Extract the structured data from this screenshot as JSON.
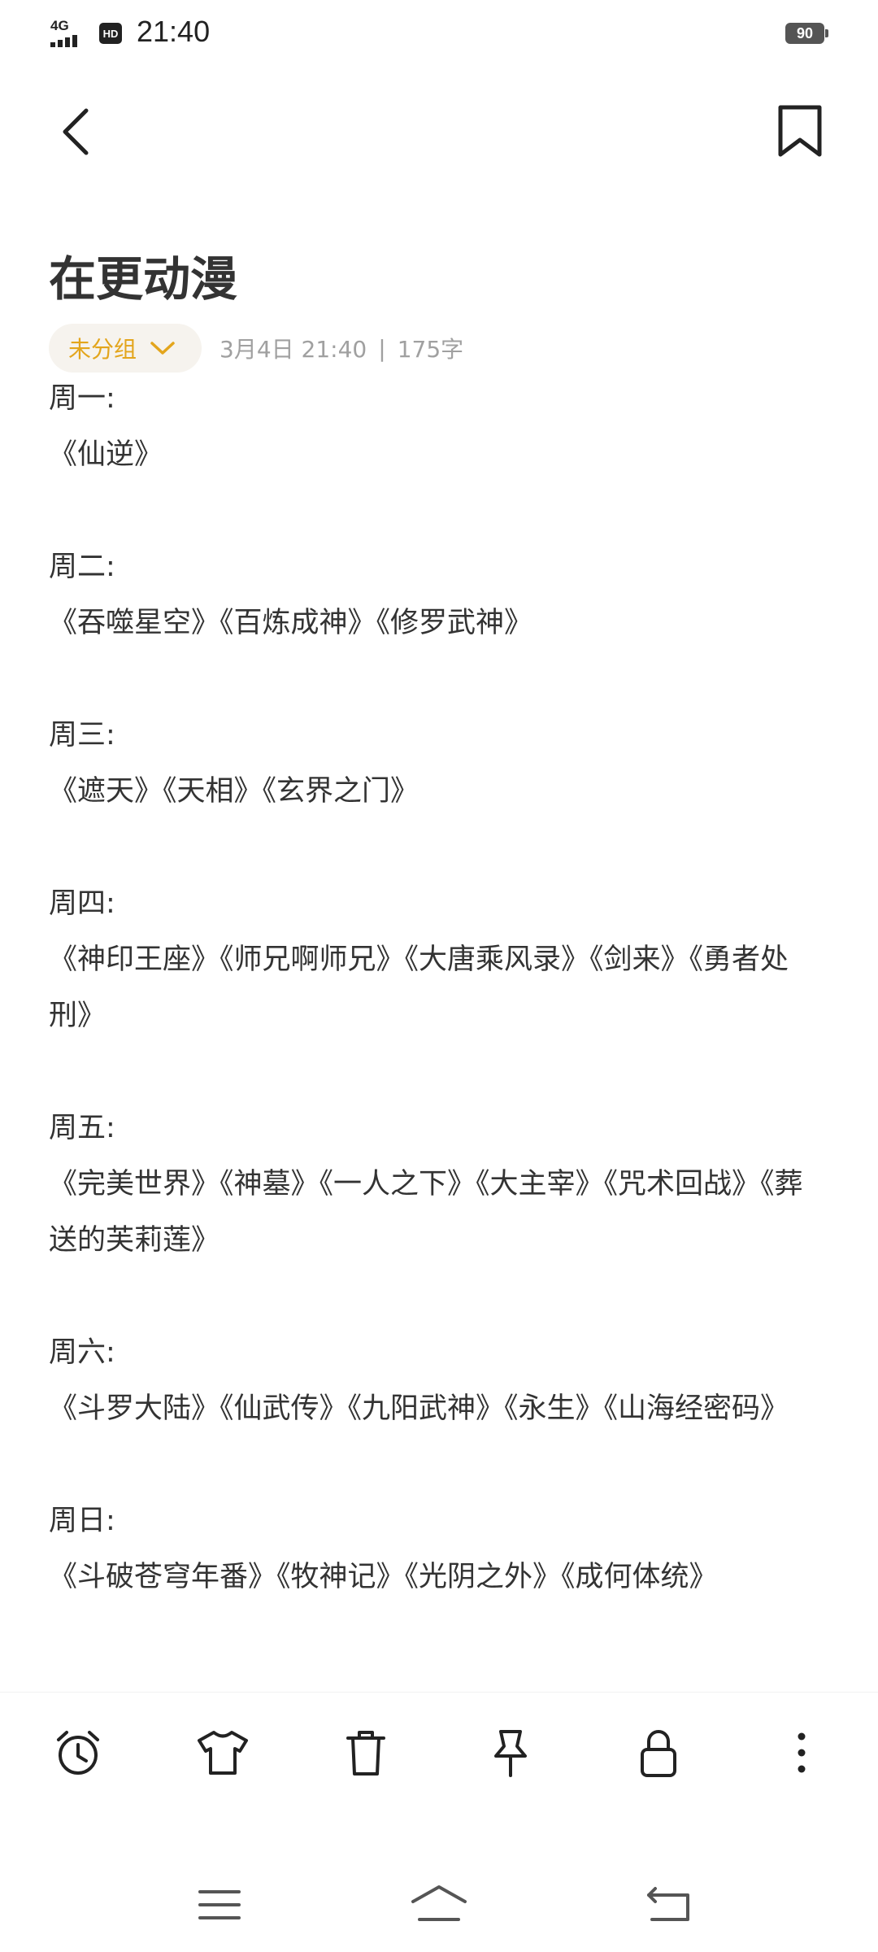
{
  "status_bar": {
    "network": "4G",
    "hd_label": "HD",
    "time": "21:40",
    "battery": "90"
  },
  "icons": {
    "back": "chevron-left-icon",
    "bookmark": "bookmark-icon",
    "alarm": "alarm-clock-icon",
    "theme": "tshirt-icon",
    "delete": "trash-icon",
    "pin": "pin-icon",
    "lock": "lock-icon",
    "more": "more-vertical-icon",
    "nav_menu": "menu-icon",
    "nav_home": "home-icon",
    "nav_back": "return-icon"
  },
  "note": {
    "title": "在更动漫",
    "group": "未分组",
    "date": "3月4日 21:40",
    "separator": "|",
    "word_count": "175字",
    "days": [
      {
        "label": "周一:",
        "shows": "《仙逆》"
      },
      {
        "label": "周二:",
        "shows": "《吞噬星空》《百炼成神》《修罗武神》"
      },
      {
        "label": "周三:",
        "shows": "《遮天》《天相》《玄界之门》"
      },
      {
        "label": "周四:",
        "shows": "《神印王座》《师兄啊师兄》《大唐乘风录》《剑来》《勇者处刑》"
      },
      {
        "label": "周五:",
        "shows": "《完美世界》《神墓》《一人之下》《大主宰》《咒术回战》《葬送的芙莉莲》"
      },
      {
        "label": "周六:",
        "shows": "《斗罗大陆》《仙武传》《九阳武神》《永生》《山海经密码》"
      },
      {
        "label": "周日:",
        "shows": "《斗破苍穹年番》《牧神记》《光阴之外》《成何体统》"
      }
    ]
  },
  "colors": {
    "accent": "#e3a51c",
    "chip_bg": "#f6f3ee",
    "text": "#333333",
    "meta": "#a0a0a0"
  }
}
